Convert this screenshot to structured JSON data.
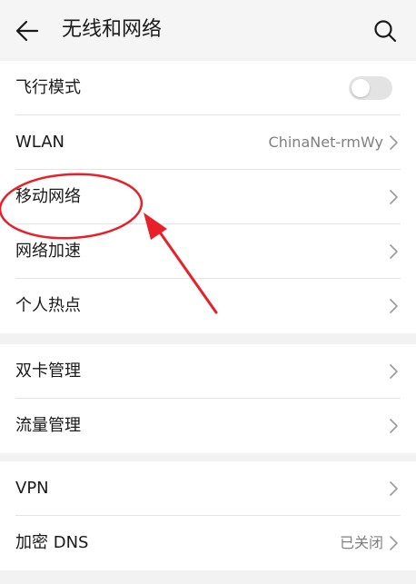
{
  "header": {
    "title": "无线和网络",
    "back_icon": "arrow-left-icon",
    "search_icon": "search-icon"
  },
  "groups": [
    {
      "items": [
        {
          "label": "飞行模式",
          "control": "toggle",
          "toggle_on": false
        },
        {
          "label": "WLAN",
          "value": "ChinaNet-rmWy",
          "control": "chevron"
        },
        {
          "label": "移动网络",
          "control": "chevron"
        },
        {
          "label": "网络加速",
          "control": "chevron"
        },
        {
          "label": "个人热点",
          "control": "chevron"
        }
      ]
    },
    {
      "items": [
        {
          "label": "双卡管理",
          "control": "chevron"
        },
        {
          "label": "流量管理",
          "control": "chevron"
        }
      ]
    },
    {
      "items": [
        {
          "label": "VPN",
          "control": "chevron"
        },
        {
          "label": "加密 DNS",
          "value": "已关闭",
          "control": "chevron"
        }
      ]
    }
  ],
  "colors": {
    "annotation": "#e8202a",
    "background": "#f2f2f2",
    "row_background": "#ffffff",
    "secondary_text": "#808080"
  }
}
